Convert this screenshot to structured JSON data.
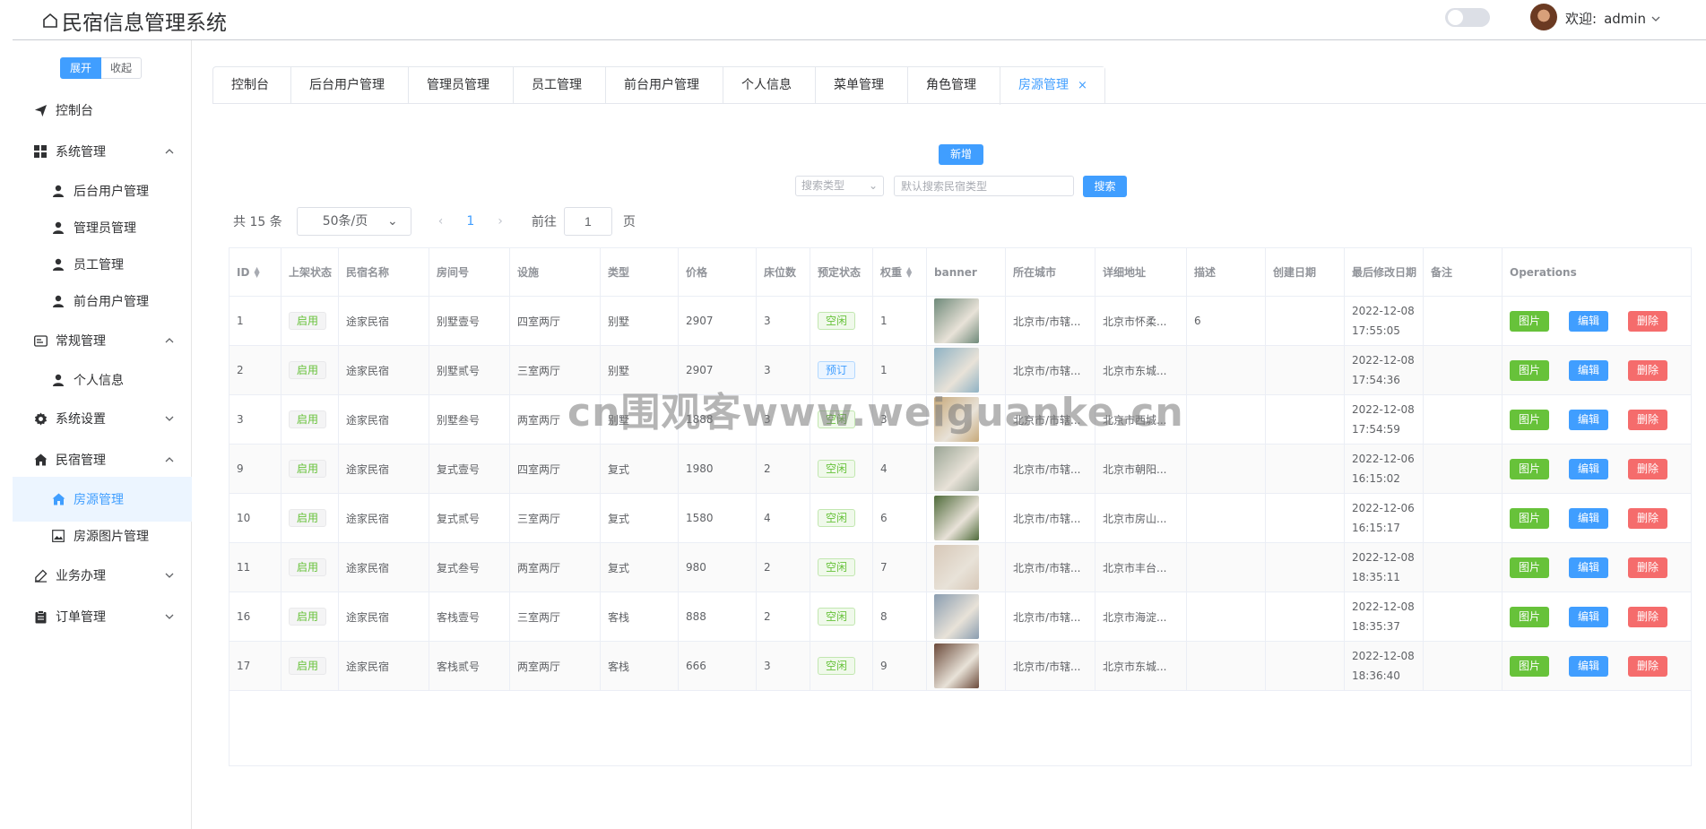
{
  "header": {
    "title": "民宿信息管理系统",
    "welcome_label": "欢迎:",
    "username": "admin"
  },
  "sidebar": {
    "expand_label": "展开",
    "collapse_label": "收起",
    "items": [
      {
        "label": "控制台",
        "level": "top",
        "icon": "paper-plane-icon"
      },
      {
        "label": "系统管理",
        "level": "top",
        "icon": "grid-icon",
        "arrow": "up"
      },
      {
        "label": "后台用户管理",
        "level": "sub",
        "icon": "user-icon"
      },
      {
        "label": "管理员管理",
        "level": "sub",
        "icon": "user-icon"
      },
      {
        "label": "员工管理",
        "level": "sub",
        "icon": "user-icon"
      },
      {
        "label": "前台用户管理",
        "level": "sub",
        "icon": "user-icon"
      },
      {
        "label": "常规管理",
        "level": "top",
        "icon": "id-card-icon",
        "arrow": "up"
      },
      {
        "label": "个人信息",
        "level": "sub",
        "icon": "user-icon"
      },
      {
        "label": "系统设置",
        "level": "top",
        "icon": "gear-icon",
        "arrow": "down"
      },
      {
        "label": "民宿管理",
        "level": "top",
        "icon": "house-icon",
        "arrow": "up"
      },
      {
        "label": "房源管理",
        "level": "sub",
        "icon": "house-icon",
        "active": true
      },
      {
        "label": "房源图片管理",
        "level": "sub",
        "icon": "picture-icon"
      },
      {
        "label": "业务办理",
        "level": "top",
        "icon": "pen-icon",
        "arrow": "down"
      },
      {
        "label": "订单管理",
        "level": "top",
        "icon": "clipboard-icon",
        "arrow": "down"
      }
    ]
  },
  "tabs": [
    "控制台",
    "后台用户管理",
    "管理员管理",
    "员工管理",
    "前台用户管理",
    "个人信息",
    "菜单管理",
    "角色管理",
    "房源管理"
  ],
  "toolbar": {
    "add_label": "新增",
    "search_type_placeholder": "搜索类型",
    "search_placeholder": "默认搜索民宿类型",
    "search_label": "搜索"
  },
  "pager": {
    "total": "共 15 条",
    "page_size": "50条/页",
    "current_page": "1",
    "goto_label": "前往",
    "goto_value": "1",
    "page_suffix": "页"
  },
  "table": {
    "headers": [
      "ID",
      "上架状态",
      "民宿名称",
      "房间号",
      "设施",
      "类型",
      "价格",
      "床位数",
      "预定状态",
      "权重",
      "banner",
      "所在城市",
      "详细地址",
      "描述",
      "创建日期",
      "最后修改日期",
      "备注",
      "Operations"
    ],
    "op_labels": {
      "pic": "图片",
      "edit": "编辑",
      "delete": "删除"
    },
    "rows": [
      {
        "id": "1",
        "status": "启用",
        "name": "途家民宿",
        "room": "别墅壹号",
        "facility": "四室两厅",
        "type": "别墅",
        "price": "2907",
        "beds": "3",
        "book": "空闲",
        "weight": "1",
        "city": "北京市/市辖...",
        "addr": "北京市怀柔...",
        "desc": "6",
        "date1": "2022-12-08",
        "date2": "17:55:05",
        "banner": "#6f8a7a"
      },
      {
        "id": "2",
        "status": "启用",
        "name": "途家民宿",
        "room": "别墅贰号",
        "facility": "三室两厅",
        "type": "别墅",
        "price": "2907",
        "beds": "3",
        "book": "预订",
        "weight": "1",
        "city": "北京市/市辖...",
        "addr": "北京市东城...",
        "desc": "",
        "date1": "2022-12-08",
        "date2": "17:54:36",
        "banner": "#8fb2c4"
      },
      {
        "id": "3",
        "status": "启用",
        "name": "途家民宿",
        "room": "别墅叁号",
        "facility": "两室两厅",
        "type": "别墅",
        "price": "1888",
        "beds": "3",
        "book": "空闲",
        "weight": "3",
        "city": "北京市/市辖...",
        "addr": "北京市西城...",
        "desc": "",
        "date1": "2022-12-08",
        "date2": "17:54:59",
        "banner": "#c7a97a"
      },
      {
        "id": "9",
        "status": "启用",
        "name": "途家民宿",
        "room": "复式壹号",
        "facility": "四室两厅",
        "type": "复式",
        "price": "1980",
        "beds": "2",
        "book": "空闲",
        "weight": "4",
        "city": "北京市/市辖...",
        "addr": "北京市朝阳...",
        "desc": "",
        "date1": "2022-12-06",
        "date2": "16:15:02",
        "banner": "#9aa595"
      },
      {
        "id": "10",
        "status": "启用",
        "name": "途家民宿",
        "room": "复式贰号",
        "facility": "三室两厅",
        "type": "复式",
        "price": "1580",
        "beds": "4",
        "book": "空闲",
        "weight": "6",
        "city": "北京市/市辖...",
        "addr": "北京市房山...",
        "desc": "",
        "date1": "2022-12-06",
        "date2": "16:15:17",
        "banner": "#4f6b3a"
      },
      {
        "id": "11",
        "status": "启用",
        "name": "途家民宿",
        "room": "复式叁号",
        "facility": "两室两厅",
        "type": "复式",
        "price": "980",
        "beds": "2",
        "book": "空闲",
        "weight": "7",
        "city": "北京市/市辖...",
        "addr": "北京市丰台...",
        "desc": "",
        "date1": "2022-12-08",
        "date2": "18:35:11",
        "banner": "#d7c8b8"
      },
      {
        "id": "16",
        "status": "启用",
        "name": "途家民宿",
        "room": "客栈壹号",
        "facility": "三室两厅",
        "type": "客栈",
        "price": "888",
        "beds": "2",
        "book": "空闲",
        "weight": "8",
        "city": "北京市/市辖...",
        "addr": "北京市海淀...",
        "desc": "",
        "date1": "2022-12-08",
        "date2": "18:35:37",
        "banner": "#8a9db0"
      },
      {
        "id": "17",
        "status": "启用",
        "name": "途家民宿",
        "room": "客栈贰号",
        "facility": "两室两厅",
        "type": "客栈",
        "price": "666",
        "beds": "3",
        "book": "空闲",
        "weight": "9",
        "city": "北京市/市辖...",
        "addr": "北京市东城...",
        "desc": "",
        "date1": "2022-12-08",
        "date2": "18:36:40",
        "banner": "#6b4a3a"
      }
    ]
  },
  "watermark": "cn围观客www.weiguanke.cn"
}
